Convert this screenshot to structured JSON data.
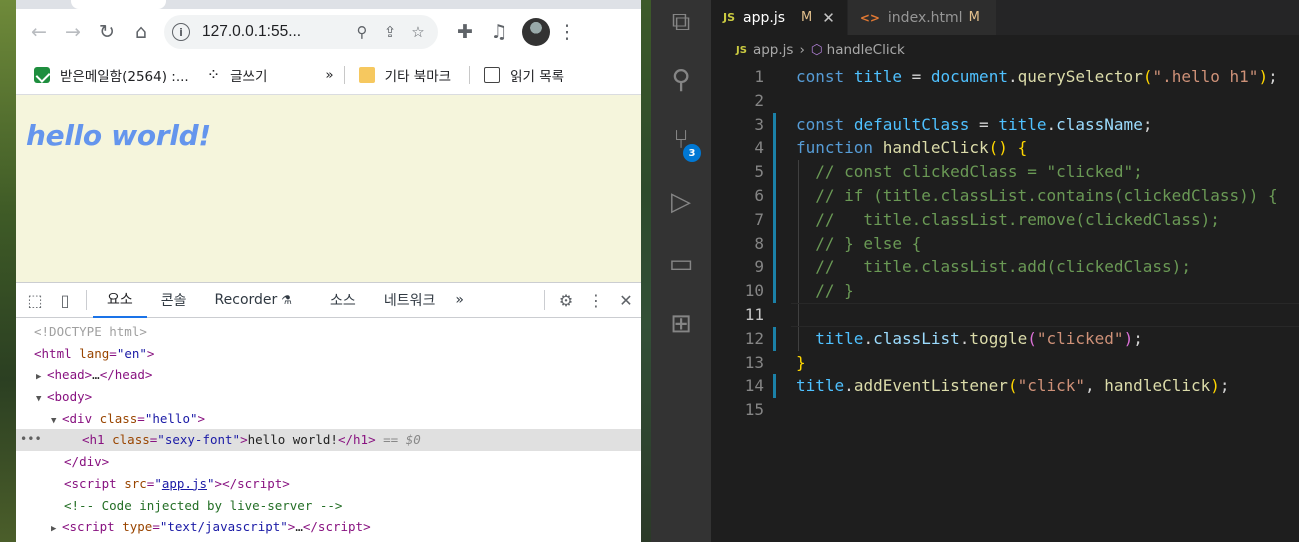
{
  "browser": {
    "url": "127.0.0.1:55...",
    "bookmarks": [
      {
        "label": "받은메일함(2564) :...",
        "icon": "mail-icon"
      },
      {
        "label": "글쓰기",
        "icon": "dots-icon"
      },
      {
        "label": "»",
        "icon": ""
      },
      {
        "label": "기타 북마크",
        "icon": "folder-icon"
      },
      {
        "label": "읽기 목록",
        "icon": "reading-list-icon"
      }
    ],
    "page_heading": "hello world!"
  },
  "devtools": {
    "tabs": [
      "요소",
      "콘솔",
      "Recorder",
      "소스",
      "네트워크"
    ],
    "more": "»",
    "dom": {
      "doctype": "<!DOCTYPE html>",
      "html_open": "html",
      "html_attr": "lang",
      "html_val": "\"en\"",
      "head": "head",
      "head_ell": "…",
      "body": "body",
      "div": "div",
      "div_attr": "class",
      "div_val": "\"hello\"",
      "h1": "h1",
      "h1_attr": "class",
      "h1_val": "\"sexy-font\"",
      "h1_text": "hello world!",
      "eq": "== $0",
      "script": "script",
      "script_attr": "src",
      "script_val": "app.js",
      "comment": "<!-- Code injected by live-server -->",
      "script2_attr": "type",
      "script2_val": "\"text/javascript\"",
      "ell": "…"
    }
  },
  "vscode": {
    "tabs": [
      {
        "icon": "JS",
        "label": "app.js",
        "status": "M",
        "active": true
      },
      {
        "icon": "<>",
        "label": "index.html",
        "status": "M",
        "active": false
      }
    ],
    "breadcrumb": {
      "file": "app.js",
      "symbol": "handleClick"
    },
    "scm_badge": "3",
    "line_numbers": [
      "1",
      "2",
      "3",
      "4",
      "5",
      "6",
      "7",
      "8",
      "9",
      "10",
      "11",
      "12",
      "13",
      "14",
      "15"
    ]
  }
}
